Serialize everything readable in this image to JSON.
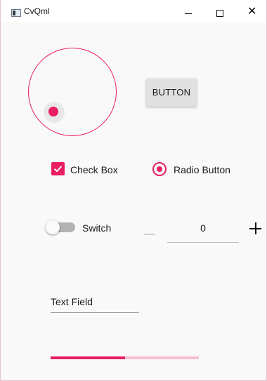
{
  "window": {
    "title": "CvQml"
  },
  "controls": {
    "button_label": "BUTTON",
    "checkbox": {
      "label": "Check Box",
      "checked": true
    },
    "radio": {
      "label": "Radio Button",
      "selected": true
    },
    "switch": {
      "label": "Switch",
      "on": false
    },
    "spinbox": {
      "value": "0"
    },
    "text_field": {
      "value": "Text Field"
    },
    "progress": {
      "value": 0.5
    }
  },
  "colors": {
    "accent": "#e91e63",
    "accent_light": "#f6bed1"
  }
}
